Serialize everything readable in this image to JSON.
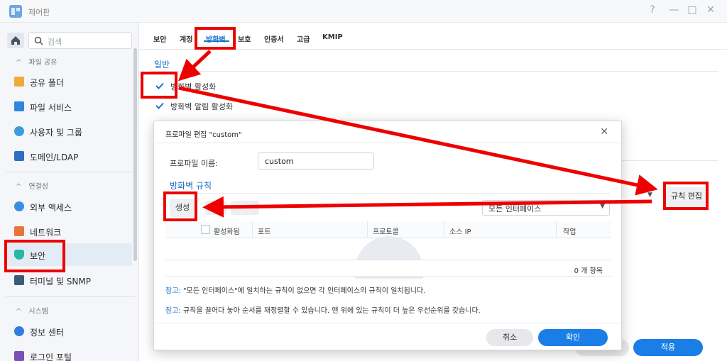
{
  "window": {
    "title": "제어판",
    "controls": [
      "?",
      "—",
      "□",
      "✕"
    ]
  },
  "sidebar": {
    "search_placeholder": "검색",
    "sections": [
      {
        "title": "파일 공유",
        "items": [
          "공유 폴더",
          "파일 서비스",
          "사용자 및 그룹",
          "도메인/LDAP"
        ]
      },
      {
        "title": "연결성",
        "items": [
          "외부 액세스",
          "네트워크",
          "보안",
          "터미널 및 SNMP"
        ]
      },
      {
        "title": "시스템",
        "items": [
          "정보 센터",
          "로그인 포털"
        ]
      }
    ],
    "active_item": "보안"
  },
  "tabs": [
    "보안",
    "계정",
    "방화벽",
    "보호",
    "인증서",
    "고급",
    "KMIP"
  ],
  "active_tab": "방화벽",
  "general": {
    "title": "일반",
    "enable_firewall": "방화벽 활성화",
    "enable_notifications": "방화벽 알림 활성화"
  },
  "main": {
    "edit_rules": "규칙 편집",
    "apply": "적용"
  },
  "dialog": {
    "title": "프로파일 편집 \"custom\"",
    "close": "✕",
    "profile_name_label": "프로파일 이름:",
    "profile_name_value": "custom",
    "rules_title": "방화벽 규칙",
    "create": "생성",
    "interface_select": "모든 인터페이스",
    "columns": [
      "활성화됨",
      "포트",
      "프로토콜",
      "소스 IP",
      "작업"
    ],
    "count": "0 개 항목",
    "note1_prefix": "참고:",
    "note1": " \"모든 인터페이스\"에 일치하는 규칙이 없으면 각 인터페이스의 규칙이 일치됩니다.",
    "note2_prefix": "참고:",
    "note2": " 규칙을 끌어다 놓아 순서를 재정렬할 수 있습니다. 맨 위에 있는 규칙이 더 높은 우선순위를 갖습니다.",
    "cancel": "취소",
    "ok": "확인"
  },
  "colors": {
    "accent": "#1a7ee6",
    "annotation": "#ee0000"
  }
}
